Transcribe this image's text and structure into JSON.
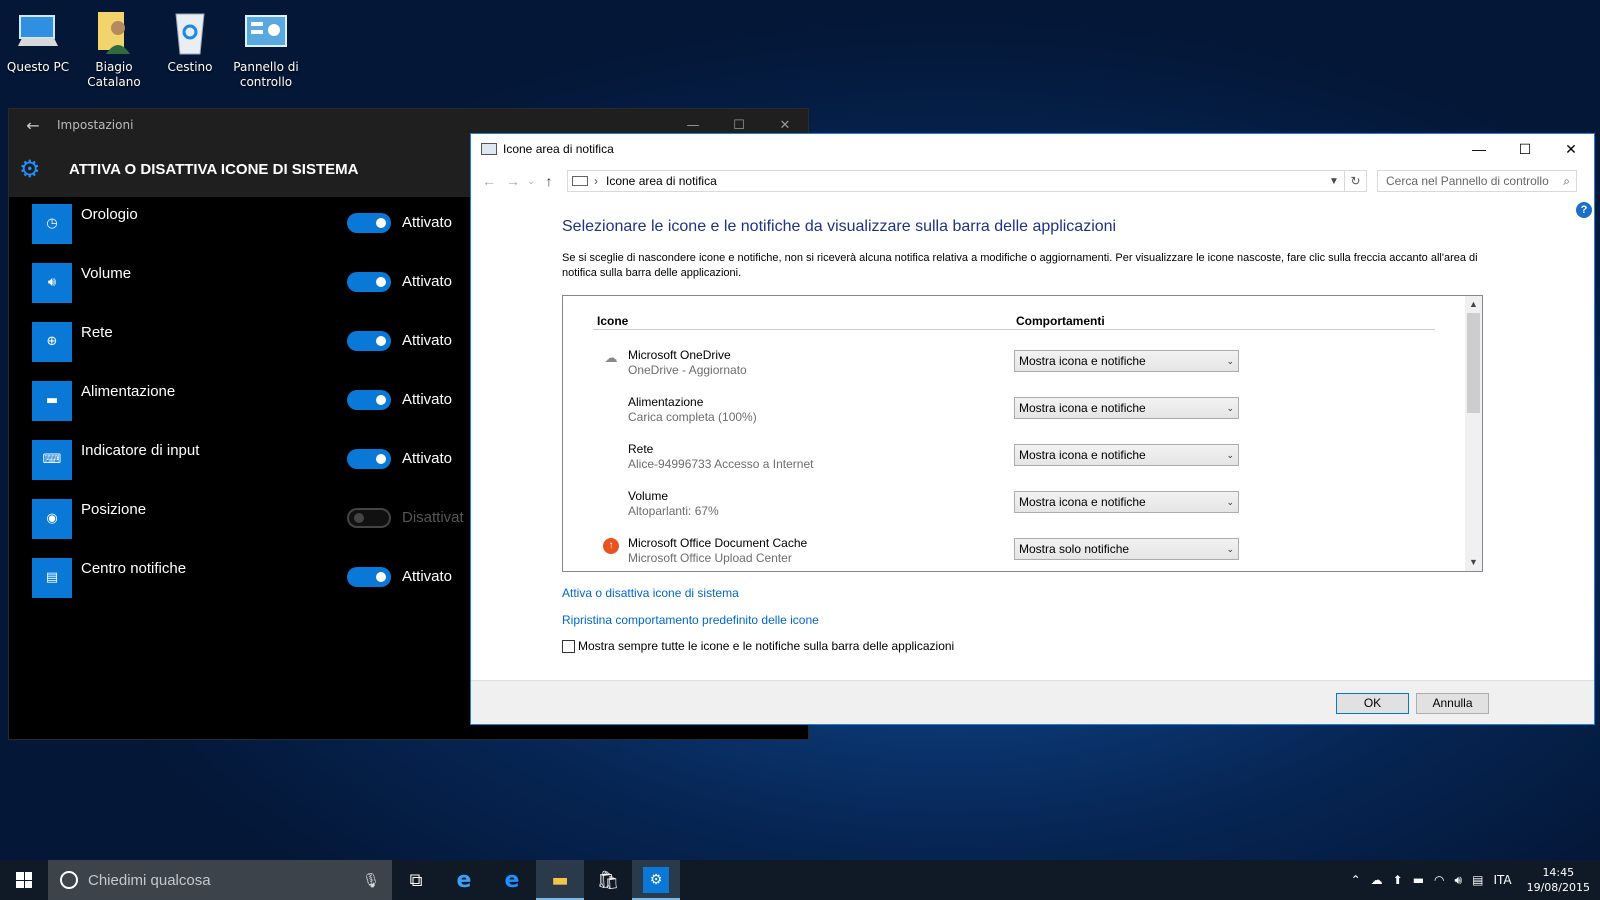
{
  "desktop": {
    "icons": [
      {
        "label": "Questo PC",
        "icon": "computer-icon"
      },
      {
        "label": "Biagio Catalano",
        "icon": "user-folder-icon"
      },
      {
        "label": "Cestino",
        "icon": "recycle-bin-icon"
      },
      {
        "label": "Pannello di controllo",
        "icon": "control-panel-icon"
      }
    ]
  },
  "settings": {
    "window_title": "Impostazioni",
    "header": "ATTIVA O DISATTIVA ICONE DI SISTEMA",
    "items": [
      {
        "label": "Orologio",
        "state": "Attivato",
        "on": true,
        "icon": "clock-icon"
      },
      {
        "label": "Volume",
        "state": "Attivato",
        "on": true,
        "icon": "volume-icon"
      },
      {
        "label": "Rete",
        "state": "Attivato",
        "on": true,
        "icon": "network-icon"
      },
      {
        "label": "Alimentazione",
        "state": "Attivato",
        "on": true,
        "icon": "battery-icon"
      },
      {
        "label": "Indicatore di input",
        "state": "Attivato",
        "on": true,
        "icon": "keyboard-icon"
      },
      {
        "label": "Posizione",
        "state": "Disattivat",
        "on": false,
        "icon": "location-icon"
      },
      {
        "label": "Centro notifiche",
        "state": "Attivato",
        "on": true,
        "icon": "action-center-icon"
      }
    ]
  },
  "control_panel": {
    "window_title": "Icone area di notifica",
    "breadcrumb": "Icone area di notifica",
    "search_placeholder": "Cerca nel Pannello di controllo",
    "heading": "Selezionare le icone e le notifiche da visualizzare sulla barra delle applicazioni",
    "description": "Se si sceglie di nascondere icone e notifiche, non si riceverà alcuna notifica relativa a modifiche o aggiornamenti. Per visualizzare le icone nascoste, fare clic sulla freccia accanto all'area di notifica sulla barra delle applicazioni.",
    "col_icons": "Icone",
    "col_behaviors": "Comportamenti",
    "rows": [
      {
        "name": "Microsoft OneDrive",
        "status": "OneDrive - Aggiornato",
        "behavior": "Mostra icona e notifiche",
        "icon": "cloud-icon"
      },
      {
        "name": "Alimentazione",
        "status": "Carica completa (100%)",
        "behavior": "Mostra icona e notifiche",
        "icon": ""
      },
      {
        "name": "Rete",
        "status": "Alice-94996733 Accesso a Internet",
        "behavior": "Mostra icona e notifiche",
        "icon": ""
      },
      {
        "name": "Volume",
        "status": "Altoparlanti: 67%",
        "behavior": "Mostra icona e notifiche",
        "icon": ""
      },
      {
        "name": "Microsoft Office Document Cache",
        "status": "Microsoft Office Upload Center",
        "behavior": "Mostra solo notifiche",
        "icon": "office-upload-icon"
      }
    ],
    "link_system_icons": "Attiva o disattiva icone di sistema",
    "link_restore": "Ripristina comportamento predefinito delle icone",
    "checkbox_label": "Mostra sempre tutte le icone e le notifiche sulla barra delle applicazioni",
    "checkbox_checked": false,
    "ok_label": "OK",
    "cancel_label": "Annulla"
  },
  "taskbar": {
    "search_placeholder": "Chiedimi qualcosa",
    "language": "ITA",
    "time": "14:45",
    "date": "19/08/2015",
    "accent_color": "#0a78d7"
  }
}
